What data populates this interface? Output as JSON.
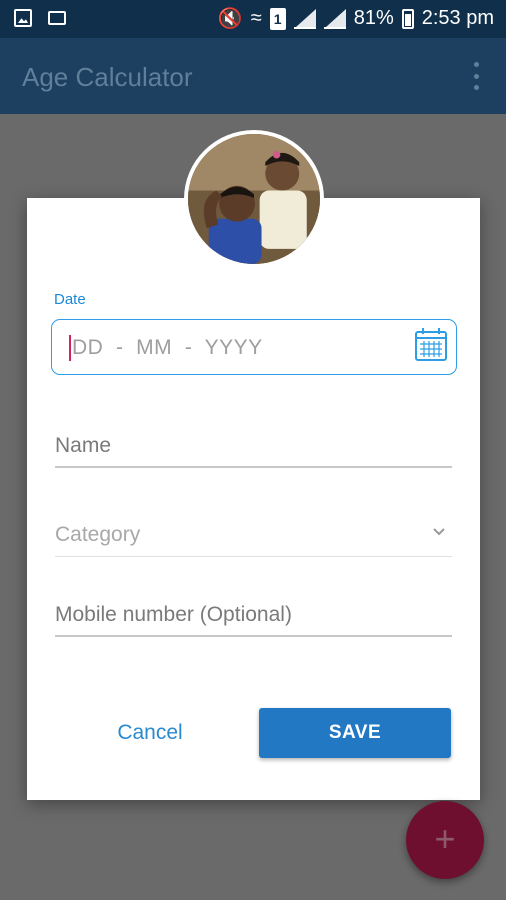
{
  "status_bar": {
    "battery_percent": "81%",
    "time": "2:53 pm",
    "sim_slot": "1"
  },
  "app_bar": {
    "title": "Age Calculator",
    "menu_icon": "overflow-menu-icon"
  },
  "dialog": {
    "date": {
      "label": "Date",
      "placeholder": "DD  -  MM  -  YYYY",
      "icon": "calendar-icon"
    },
    "name": {
      "placeholder": "Name"
    },
    "category": {
      "placeholder": "Category",
      "icon": "chevron-down-icon"
    },
    "mobile": {
      "placeholder": "Mobile number (Optional)"
    },
    "cancel_label": "Cancel",
    "save_label": "SAVE"
  },
  "fab": {
    "label": "+"
  },
  "colors": {
    "accent": "#2378c4",
    "app_bar": "#1d4060",
    "status_bar": "#0f2f4a",
    "fab": "#6f0f2f"
  }
}
